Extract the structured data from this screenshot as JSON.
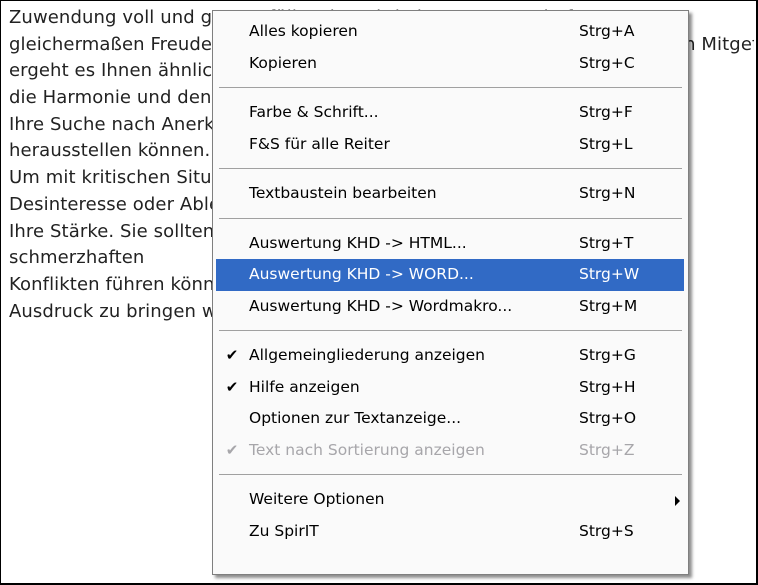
{
  "document": {
    "lines": [
      "Zuwendung voll und ganz erfüllt. Dies wird einer Partnerschaft",
      "gleichermaßen Freude bereiten. Mit Ihrem Einfühlungsvermögen und Ihrem Mitgefühl",
      "ergeht es Ihnen ähnlich im Beruf. Ihre Kollegen und Mitarbeiter",
      "die Harmonie und den Zusammenhalt. Spannungen und Anspannung",
      "Ihre Suche nach Anerkennung kann sich als eingeschränkt",
      "herausstellen können.",
      "Um mit kritischen Situationen umzugehen, sollten Sie gelegentlich",
      "Desinteresse oder Ablehnung in Kauf nehmen. Ihre Flexibilität,",
      "Ihre Stärke. Sie sollten dabei bedenken, dass konservative",
      "schmerzhaften",
      "Konflikten führen können, wenn Sie nur den Aufzug",
      "Ausdruck zu bringen wissen, der in der Beziehung"
    ]
  },
  "context_menu": {
    "items": [
      {
        "type": "item",
        "label": "Alles kopieren",
        "shortcut": "Strg+A",
        "checked": false,
        "disabled": false,
        "highlighted": false,
        "submenu": false
      },
      {
        "type": "item",
        "label": "Kopieren",
        "shortcut": "Strg+C",
        "checked": false,
        "disabled": false,
        "highlighted": false,
        "submenu": false
      },
      {
        "type": "separator"
      },
      {
        "type": "item",
        "label": "Farbe & Schrift...",
        "shortcut": "Strg+F",
        "checked": false,
        "disabled": false,
        "highlighted": false,
        "submenu": false
      },
      {
        "type": "item",
        "label": "F&S für alle Reiter",
        "shortcut": "Strg+L",
        "checked": false,
        "disabled": false,
        "highlighted": false,
        "submenu": false
      },
      {
        "type": "separator"
      },
      {
        "type": "item",
        "label": "Textbaustein bearbeiten",
        "shortcut": "Strg+N",
        "checked": false,
        "disabled": false,
        "highlighted": false,
        "submenu": false
      },
      {
        "type": "separator"
      },
      {
        "type": "item",
        "label": "Auswertung KHD -> HTML...",
        "shortcut": "Strg+T",
        "checked": false,
        "disabled": false,
        "highlighted": false,
        "submenu": false
      },
      {
        "type": "item",
        "label": "Auswertung KHD -> WORD...",
        "shortcut": "Strg+W",
        "checked": false,
        "disabled": false,
        "highlighted": true,
        "submenu": false
      },
      {
        "type": "item",
        "label": "Auswertung KHD -> Wordmakro...",
        "shortcut": "Strg+M",
        "checked": false,
        "disabled": false,
        "highlighted": false,
        "submenu": false
      },
      {
        "type": "separator"
      },
      {
        "type": "item",
        "label": "Allgemeingliederung anzeigen",
        "shortcut": "Strg+G",
        "checked": true,
        "disabled": false,
        "highlighted": false,
        "submenu": false
      },
      {
        "type": "item",
        "label": "Hilfe anzeigen",
        "shortcut": "Strg+H",
        "checked": true,
        "disabled": false,
        "highlighted": false,
        "submenu": false
      },
      {
        "type": "item",
        "label": "Optionen zur Textanzeige...",
        "shortcut": "Strg+O",
        "checked": false,
        "disabled": false,
        "highlighted": false,
        "submenu": false
      },
      {
        "type": "item",
        "label": "Text nach Sortierung anzeigen",
        "shortcut": "Strg+Z",
        "checked": true,
        "disabled": true,
        "highlighted": false,
        "submenu": false
      },
      {
        "type": "separator"
      },
      {
        "type": "item",
        "label": "Weitere Optionen",
        "shortcut": "",
        "checked": false,
        "disabled": false,
        "highlighted": false,
        "submenu": true
      },
      {
        "type": "item",
        "label": "Zu SpirIT",
        "shortcut": "Strg+S",
        "checked": false,
        "disabled": false,
        "highlighted": false,
        "submenu": false
      }
    ],
    "check_glyph": "✔",
    "colors": {
      "highlight": "#316ac5",
      "disabled_text": "#a7a6aa",
      "separator": "#a0a0a0"
    }
  }
}
